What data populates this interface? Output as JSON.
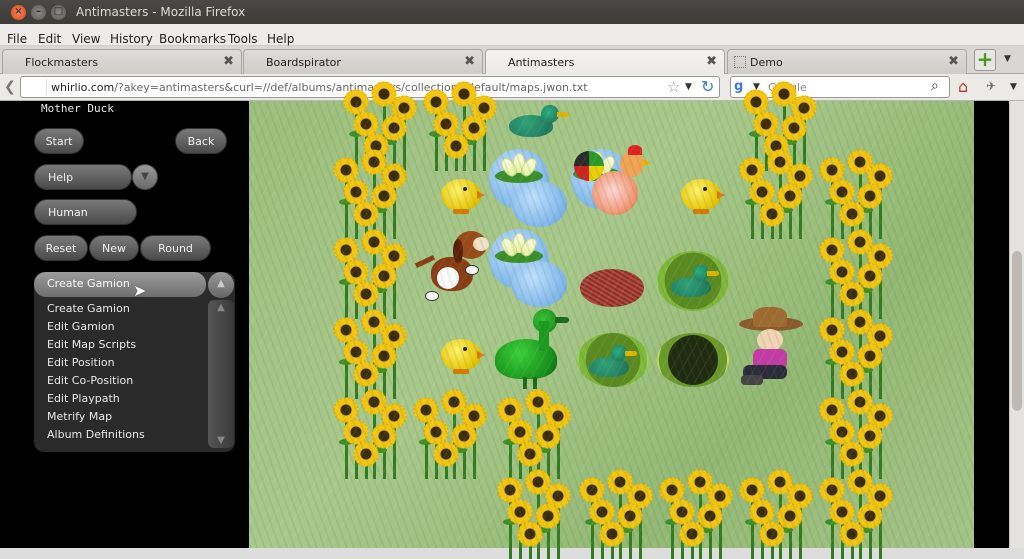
{
  "window": {
    "title": "Antimasters - Mozilla Firefox"
  },
  "menu": {
    "items": [
      "File",
      "Edit",
      "View",
      "History",
      "Bookmarks",
      "Tools",
      "Help"
    ]
  },
  "tabs": [
    {
      "label": "Flockmasters",
      "active": false
    },
    {
      "label": "Boardspirator",
      "active": false
    },
    {
      "label": "Antimasters",
      "active": true
    },
    {
      "label": "Demo",
      "active": false
    }
  ],
  "nav": {
    "url_host": "whirlio.com",
    "url_rest": "/?akey=antimasters&curl=//def/albums/antimasters/collections/default/maps.jwon.txt",
    "search_placeholder": "Google"
  },
  "panel": {
    "title": "Mother Duck",
    "start_label": "Start",
    "back_label": "Back",
    "help_label": "Help",
    "human_label": "Human",
    "reset_label": "Reset",
    "new_label": "New",
    "round_label": "Round",
    "dropdown": {
      "selected": "Create Gamion",
      "options": [
        "Create Gamion",
        "Edit Gamion",
        "Edit Map Scripts",
        "Edit Position",
        "Edit Co-Position",
        "Edit Playpath",
        "Metrify Map",
        "Album Definitions"
      ]
    }
  },
  "colors": {
    "grass": "#a5c488",
    "panel_bg": "#000000",
    "button": "#5e5e5e",
    "flower": "#f5c80f",
    "duck": "#1a6e55"
  }
}
